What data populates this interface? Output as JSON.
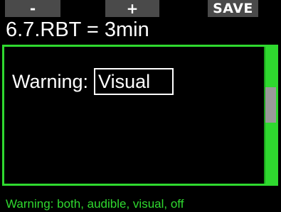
{
  "softkeys": {
    "left_label": "-",
    "middle_label": "+",
    "right_label": "SAVE"
  },
  "header": {
    "title": "6.7.RBT = 3min"
  },
  "setting": {
    "label": "Warning:",
    "value": "Visual"
  },
  "help": {
    "text": "Warning: both, audible, visual, off"
  },
  "scrollbar": {
    "position_fraction": 0.4
  },
  "colors": {
    "accent_green": "#2fd92f",
    "softkey_gray": "#4a4a4a",
    "scroll_thumb_gray": "#9a9a9a",
    "background": "#000000",
    "text": "#ffffff"
  }
}
